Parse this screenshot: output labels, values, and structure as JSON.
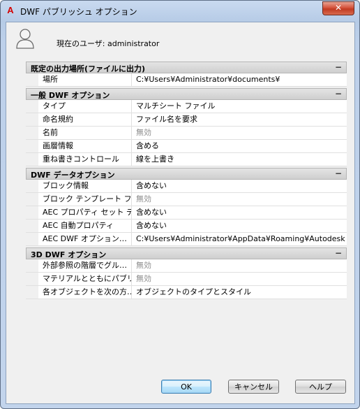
{
  "window": {
    "title": "DWF パブリッシュ オプション"
  },
  "user": {
    "label": "現在のユーザ: administrator"
  },
  "sections": [
    {
      "title": "既定の出力場所(ファイルに出力)",
      "collapse_symbol": "−",
      "rows": [
        {
          "name": "場所",
          "value": "C:¥Users¥Administrator¥documents¥",
          "disabled": false
        }
      ]
    },
    {
      "title": "一般 DWF オプション",
      "collapse_symbol": "−",
      "rows": [
        {
          "name": "タイプ",
          "value": "マルチシート ファイル",
          "disabled": false
        },
        {
          "name": "命名規約",
          "value": "ファイル名を要求",
          "disabled": false
        },
        {
          "name": "名前",
          "value": "無効",
          "disabled": true
        },
        {
          "name": "画層情報",
          "value": "含める",
          "disabled": false
        },
        {
          "name": "重ね書きコントロール",
          "value": "線を上書き",
          "disabled": false
        }
      ]
    },
    {
      "title": "DWF データオプション",
      "collapse_symbol": "−",
      "rows": [
        {
          "name": "ブロック情報",
          "value": "含めない",
          "disabled": false
        },
        {
          "name": "ブロック テンプレート ファ…",
          "value": "無効",
          "disabled": true
        },
        {
          "name": "AEC プロパティ セット デ…",
          "value": "含めない",
          "disabled": false
        },
        {
          "name": "AEC 自動プロパティ",
          "value": "含めない",
          "disabled": false
        },
        {
          "name": "AEC DWF オプション…",
          "value": "C:¥Users¥Administrator¥AppData¥Roaming¥Autodesk…",
          "disabled": false
        }
      ]
    },
    {
      "title": "3D DWF オプション",
      "collapse_symbol": "−",
      "rows": [
        {
          "name": "外部参照の階層でグル…",
          "value": "無効",
          "disabled": true
        },
        {
          "name": "マテリアルとともにパブリッ…",
          "value": "無効",
          "disabled": true
        },
        {
          "name": "各オブジェクトを次の方…",
          "value": "オブジェクトのタイプとスタイル",
          "disabled": false
        }
      ]
    }
  ],
  "buttons": {
    "ok": "OK",
    "cancel": "キャンセル",
    "help": "ヘルプ"
  },
  "colors": {
    "disabled_text": "#8c8c8c",
    "close_button": "#c13a22",
    "app_icon": "#d40000"
  }
}
